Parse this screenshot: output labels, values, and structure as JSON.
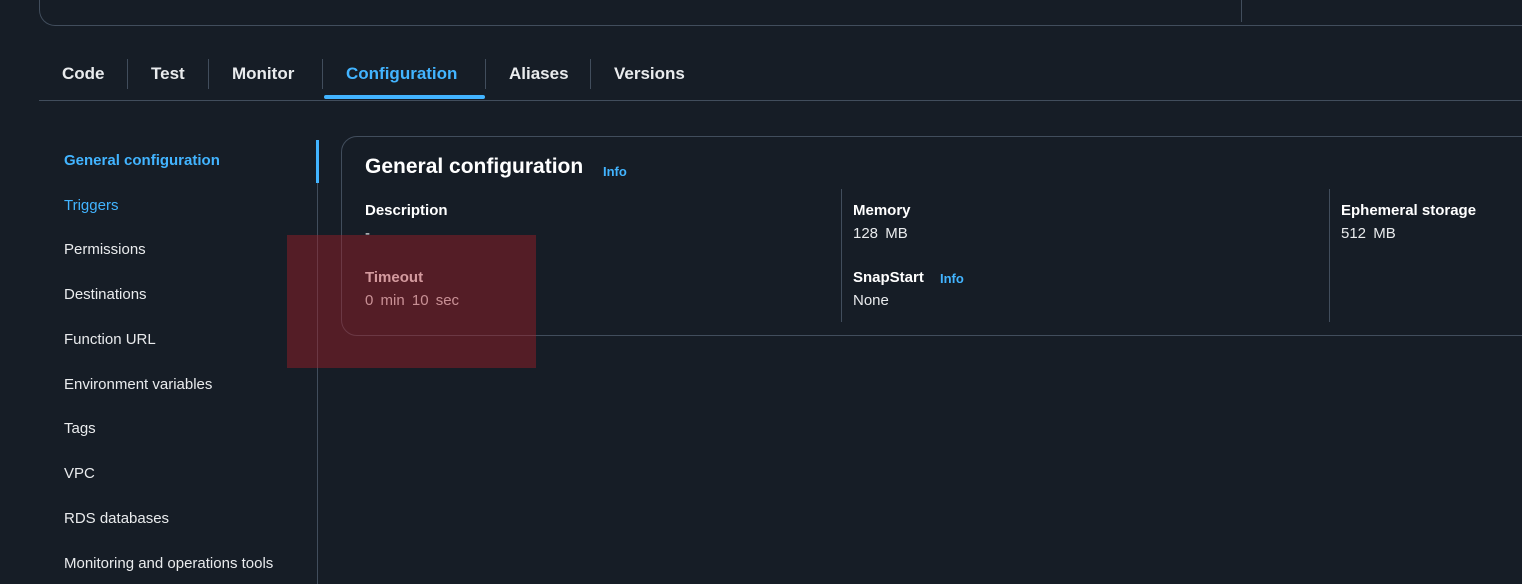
{
  "tabs": [
    {
      "label": "Code",
      "active": false
    },
    {
      "label": "Test",
      "active": false
    },
    {
      "label": "Monitor",
      "active": false
    },
    {
      "label": "Configuration",
      "active": true
    },
    {
      "label": "Aliases",
      "active": false
    },
    {
      "label": "Versions",
      "active": false
    }
  ],
  "sidenav": {
    "items": [
      {
        "label": "General configuration",
        "state": "active"
      },
      {
        "label": "Triggers",
        "state": "link"
      },
      {
        "label": "Permissions",
        "state": "normal"
      },
      {
        "label": "Destinations",
        "state": "normal"
      },
      {
        "label": "Function URL",
        "state": "normal"
      },
      {
        "label": "Environment variables",
        "state": "normal"
      },
      {
        "label": "Tags",
        "state": "normal"
      },
      {
        "label": "VPC",
        "state": "normal"
      },
      {
        "label": "RDS databases",
        "state": "normal"
      },
      {
        "label": "Monitoring and operations tools",
        "state": "normal"
      }
    ]
  },
  "panel": {
    "title": "General configuration",
    "title_info": "Info",
    "description": {
      "label": "Description",
      "value": "-"
    },
    "timeout": {
      "label": "Timeout",
      "value": "0  min   10  sec"
    },
    "memory": {
      "label": "Memory",
      "value": "128  MB"
    },
    "snapstart": {
      "label": "SnapStart",
      "info": "Info",
      "value": "None"
    },
    "ephemeral": {
      "label": "Ephemeral storage",
      "value": "512  MB"
    }
  },
  "colors": {
    "background": "#161d26",
    "accent": "#42b4ff",
    "border": "#414d5c",
    "highlight": "rgba(160,30,40,0.45)"
  }
}
